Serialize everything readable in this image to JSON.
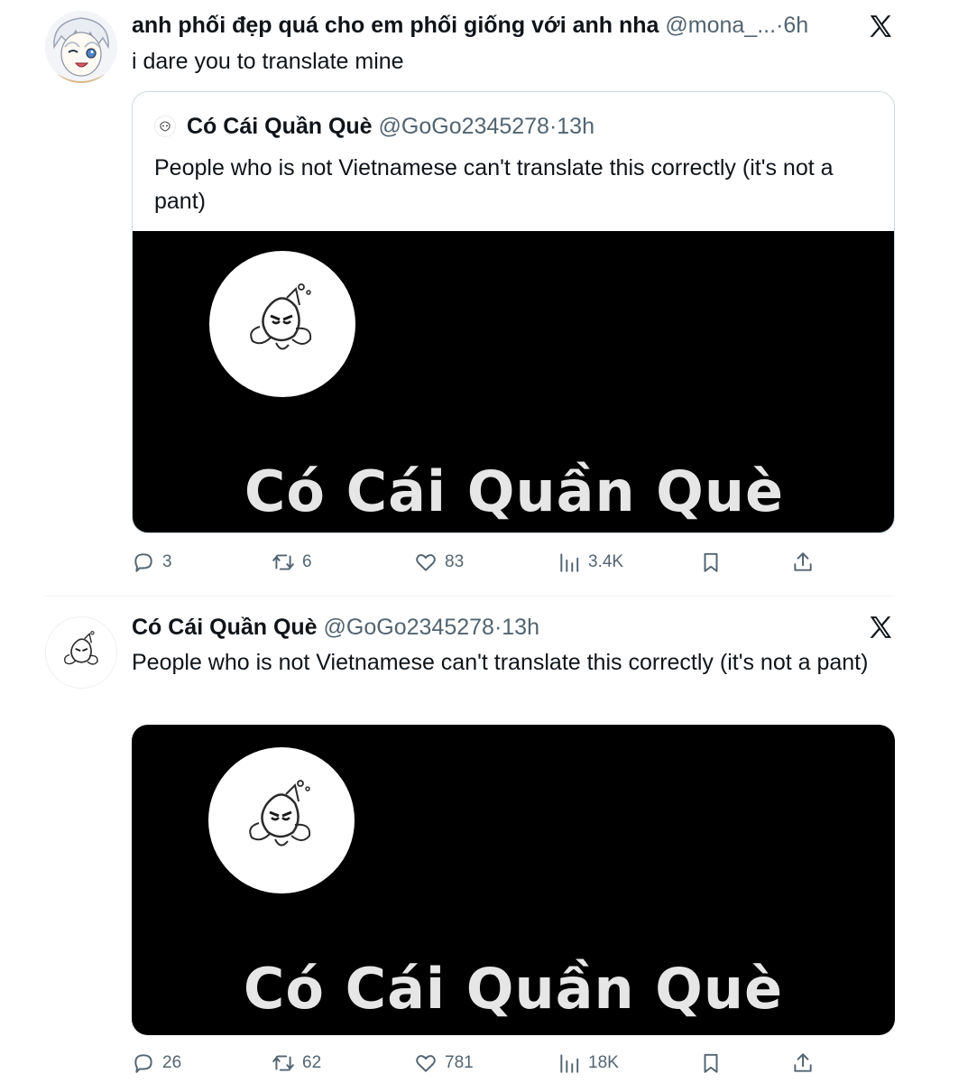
{
  "tweet1": {
    "name": "anh phối đẹp quá cho em phối giống với anh nha",
    "handle": "@mona_...",
    "separator": "·",
    "time": "6h",
    "text": "i dare you to translate mine",
    "quote": {
      "name": "Có Cái Quần Què",
      "handle": "@GoGo2345278",
      "separator": "·",
      "time": "13h",
      "text": "People who is not Vietnamese can't translate this correctly (it's not a pant)",
      "media_title": "Có Cái Quần Què"
    },
    "actions": {
      "replies": "3",
      "retweets": "6",
      "likes": "83",
      "views": "3.4K"
    }
  },
  "tweet2": {
    "name": "Có Cái Quần Què",
    "handle": "@GoGo2345278",
    "separator": "·",
    "time": "13h",
    "text": "People who is not Vietnamese can't translate this correctly (it's not a pant)",
    "media_title": "Có Cái Quần Què",
    "actions": {
      "replies": "26",
      "retweets": "62",
      "likes": "781",
      "views": "18K"
    }
  },
  "icons": {
    "reply": "speech-bubble-icon",
    "retweet": "retweet-arrows-icon",
    "like": "heart-icon",
    "views": "bar-chart-icon",
    "bookmark": "bookmark-icon",
    "share": "share-upload-icon",
    "platform": "x-logo-icon"
  },
  "colors": {
    "text": "#0f1419",
    "secondary": "#536471",
    "border": "#cfd9de",
    "media_bg": "#000000"
  }
}
